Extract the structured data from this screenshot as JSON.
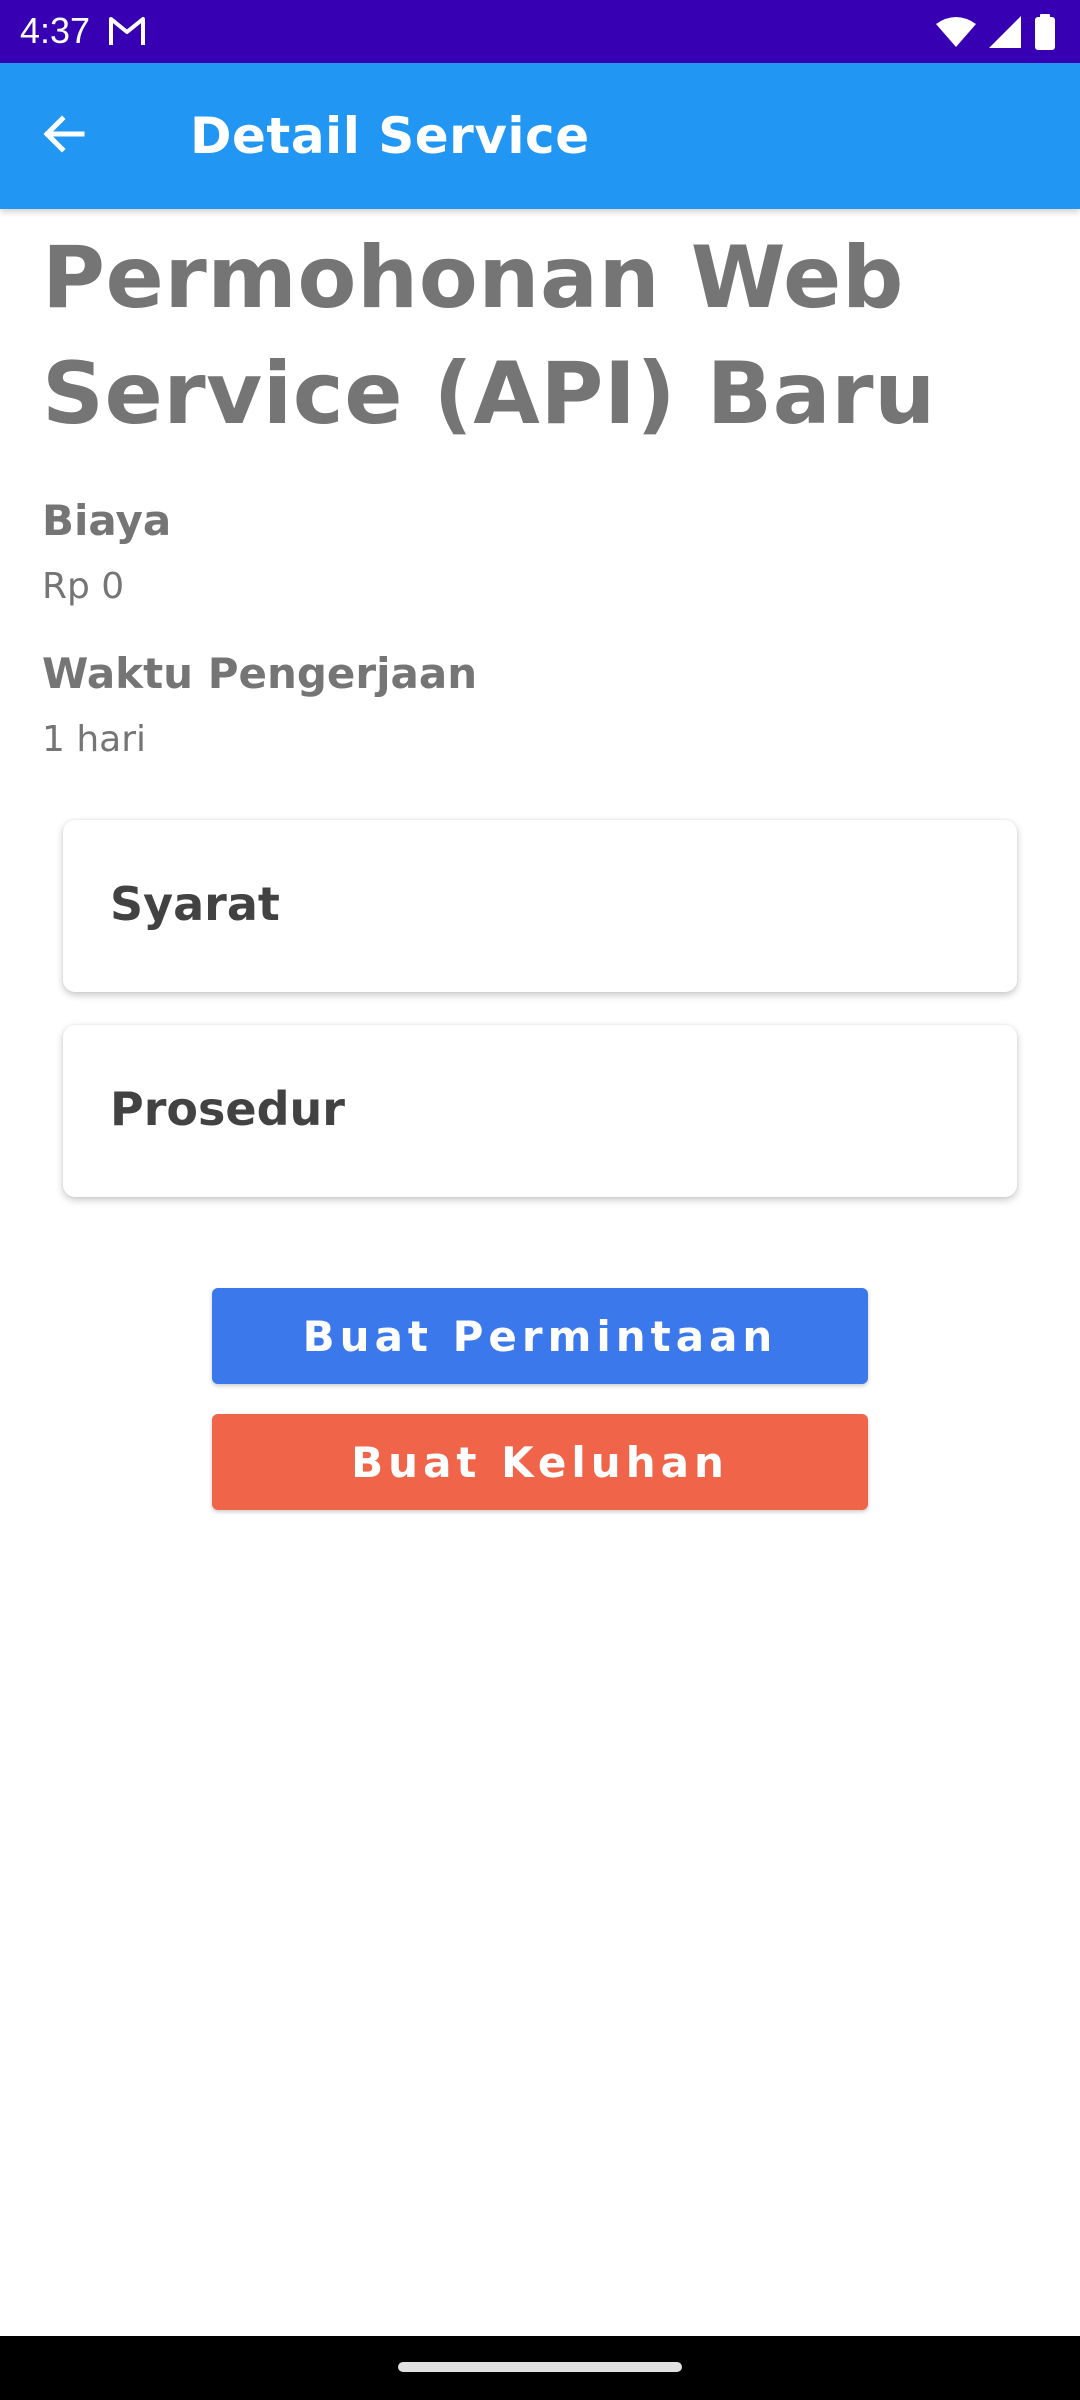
{
  "status_bar": {
    "time": "4:37",
    "background_color": "#3700b3",
    "icons": [
      "gmail-icon",
      "wifi-icon",
      "signal-icon",
      "battery-icon"
    ]
  },
  "app_bar": {
    "title": "Detail Service",
    "background_color": "#2196f3",
    "back_icon": "arrow-back-icon"
  },
  "service": {
    "title": "Permohonan Web Service (API) Baru",
    "cost": {
      "label": "Biaya",
      "value": "Rp 0"
    },
    "duration": {
      "label": "Waktu Pengerjaan",
      "value": "1 hari"
    }
  },
  "sections": [
    {
      "label": "Syarat"
    },
    {
      "label": "Prosedur"
    }
  ],
  "actions": {
    "request_label": "Buat Permintaan",
    "request_color": "#3b78ec",
    "complaint_label": "Buat Keluhan",
    "complaint_color": "#f0654a"
  }
}
